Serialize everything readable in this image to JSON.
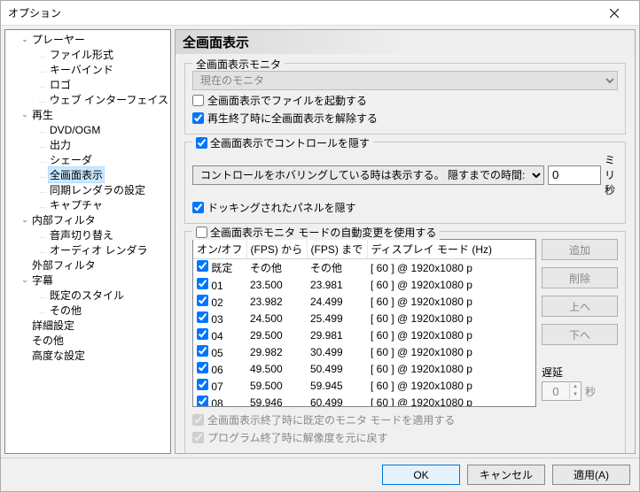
{
  "window": {
    "title": "オプション"
  },
  "tree": [
    {
      "label": "プレーヤー",
      "depth": 1,
      "exp": "v"
    },
    {
      "label": "ファイル形式",
      "depth": 2
    },
    {
      "label": "キーバインド",
      "depth": 2
    },
    {
      "label": "ロゴ",
      "depth": 2
    },
    {
      "label": "ウェブ インターフェイス",
      "depth": 2
    },
    {
      "label": "再生",
      "depth": 1,
      "exp": "v"
    },
    {
      "label": "DVD/OGM",
      "depth": 2
    },
    {
      "label": "出力",
      "depth": 2
    },
    {
      "label": "シェーダ",
      "depth": 2
    },
    {
      "label": "全画面表示",
      "depth": 2,
      "sel": true
    },
    {
      "label": "同期レンダラの設定",
      "depth": 2
    },
    {
      "label": "キャプチャ",
      "depth": 2
    },
    {
      "label": "内部フィルタ",
      "depth": 1,
      "exp": "v"
    },
    {
      "label": "音声切り替え",
      "depth": 2
    },
    {
      "label": "オーディオ レンダラ",
      "depth": 2
    },
    {
      "label": "外部フィルタ",
      "depth": 1
    },
    {
      "label": "字幕",
      "depth": 1,
      "exp": "v"
    },
    {
      "label": "既定のスタイル",
      "depth": 2
    },
    {
      "label": "その他",
      "depth": 2
    },
    {
      "label": "詳細設定",
      "depth": 1
    },
    {
      "label": "その他",
      "depth": 1
    },
    {
      "label": "高度な設定",
      "depth": 1
    }
  ],
  "heading": "全画面表示",
  "grp_monitor": {
    "legend": "全画面表示モニタ",
    "select": "現在のモニタ",
    "chk_launch": {
      "checked": false,
      "label": "全画面表示でファイルを起動する"
    },
    "chk_exit": {
      "checked": true,
      "label": "再生終了時に全画面表示を解除する"
    }
  },
  "grp_hidectrl": {
    "legend_checked": true,
    "legend": "全画面表示でコントロールを隠す",
    "select": "コントロールをホバリングしている時は表示する。  隠すまでの時間:",
    "timeout_value": "0",
    "timeout_unit": "ミリ秒",
    "chk_dock": {
      "checked": true,
      "label": "ドッキングされたパネルを隠す"
    }
  },
  "grp_autochange": {
    "legend_checked": false,
    "legend": "全画面表示モニタ モードの自動変更を使用する",
    "cols": [
      "オン/オフ",
      "(FPS) から",
      "(FPS) まで",
      "ディスプレイ モード (Hz)"
    ],
    "rows": [
      {
        "chk": true,
        "name": "既定",
        "from": "その他",
        "to": "その他",
        "mode": "[ 60 ] @ 1920x1080 p"
      },
      {
        "chk": true,
        "name": "01",
        "from": "23.500",
        "to": "23.981",
        "mode": "[ 60 ] @ 1920x1080 p"
      },
      {
        "chk": true,
        "name": "02",
        "from": "23.982",
        "to": "24.499",
        "mode": "[ 60 ] @ 1920x1080 p"
      },
      {
        "chk": true,
        "name": "03",
        "from": "24.500",
        "to": "25.499",
        "mode": "[ 60 ] @ 1920x1080 p"
      },
      {
        "chk": true,
        "name": "04",
        "from": "29.500",
        "to": "29.981",
        "mode": "[ 60 ] @ 1920x1080 p"
      },
      {
        "chk": true,
        "name": "05",
        "from": "29.982",
        "to": "30.499",
        "mode": "[ 60 ] @ 1920x1080 p"
      },
      {
        "chk": true,
        "name": "06",
        "from": "49.500",
        "to": "50.499",
        "mode": "[ 60 ] @ 1920x1080 p"
      },
      {
        "chk": true,
        "name": "07",
        "from": "59.500",
        "to": "59.945",
        "mode": "[ 60 ] @ 1920x1080 p"
      },
      {
        "chk": true,
        "name": "08",
        "from": "59.946",
        "to": "60.499",
        "mode": "[ 60 ] @ 1920x1080 p"
      }
    ],
    "btn_add": "追加",
    "btn_del": "削除",
    "btn_up": "上へ",
    "btn_down": "下へ",
    "delay_label": "遅延",
    "delay_value": "0",
    "delay_unit": "秒",
    "chk_restore_exit": {
      "checked": true,
      "label": "全画面表示終了時に既定のモニタ モードを適用する"
    },
    "chk_restore_prog": {
      "checked": true,
      "label": "プログラム終了時に解像度を元に戻す"
    }
  },
  "footer": {
    "ok": "OK",
    "cancel": "キャンセル",
    "apply": "適用(A)"
  }
}
